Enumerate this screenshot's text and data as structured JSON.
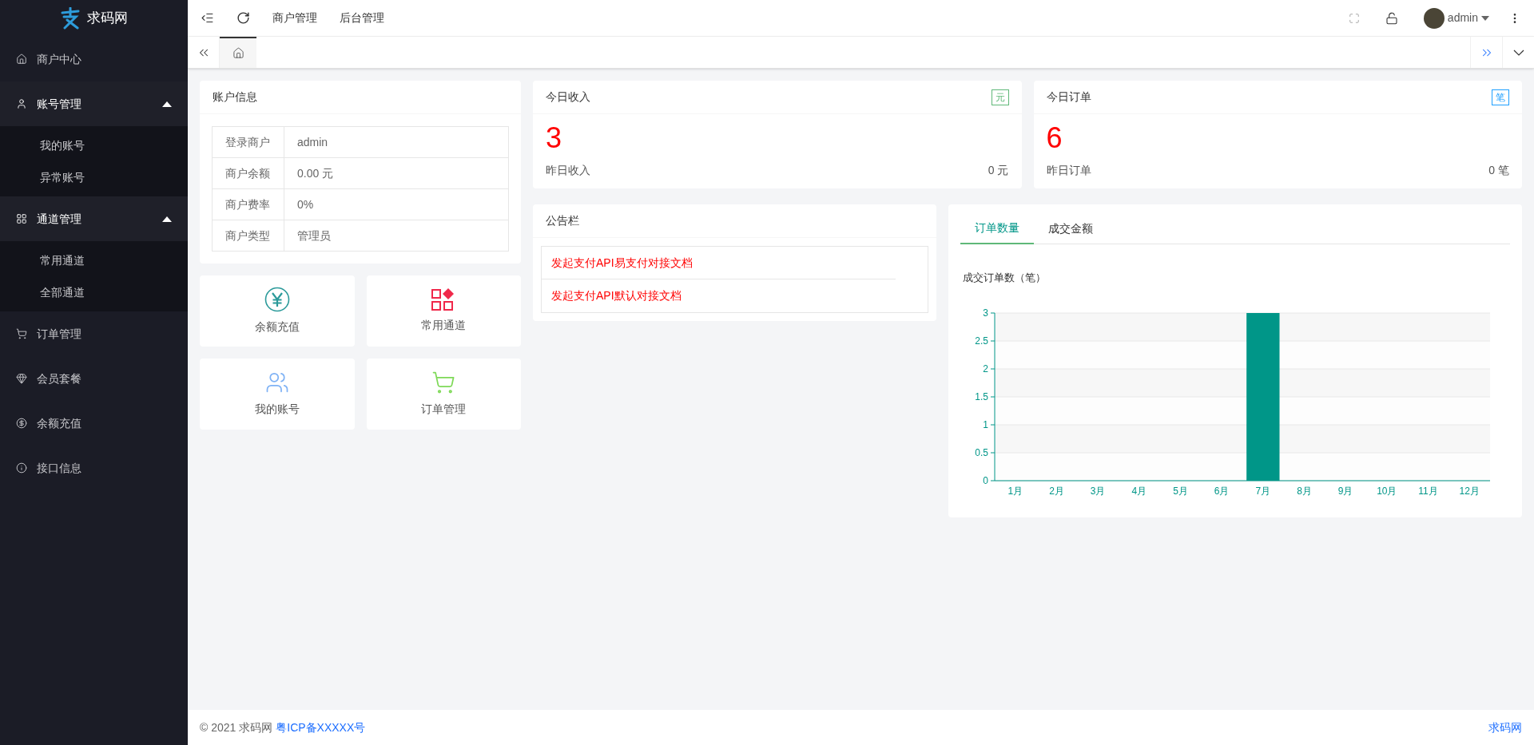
{
  "brand": {
    "name": "求码网"
  },
  "sidebar": {
    "items": [
      {
        "label": "商户中心"
      },
      {
        "label": "账号管理",
        "expanded": true,
        "children": [
          {
            "label": "我的账号"
          },
          {
            "label": "异常账号"
          }
        ]
      },
      {
        "label": "通道管理",
        "expanded": true,
        "children": [
          {
            "label": "常用通道"
          },
          {
            "label": "全部通道"
          }
        ]
      },
      {
        "label": "订单管理"
      },
      {
        "label": "会员套餐"
      },
      {
        "label": "余额充值"
      },
      {
        "label": "接口信息"
      }
    ]
  },
  "header": {
    "links": [
      "商户管理",
      "后台管理"
    ],
    "user": "admin"
  },
  "page_tabs": [
    {
      "selected": true
    }
  ],
  "account_info": {
    "title": "账户信息",
    "rows": [
      {
        "label": "登录商户",
        "value": "admin"
      },
      {
        "label": "商户余额",
        "value": "0.00 元"
      },
      {
        "label": "商户费率",
        "value": "0%"
      },
      {
        "label": "商户类型",
        "value": "管理员"
      }
    ]
  },
  "shortcuts": [
    {
      "label": "余额充值"
    },
    {
      "label": "常用通道"
    },
    {
      "label": "我的账号"
    },
    {
      "label": "订单管理"
    }
  ],
  "stats": [
    {
      "title": "今日收入",
      "badge": "元",
      "color": "#5fb878",
      "value": "3",
      "sub_label": "昨日收入",
      "sub_value": "0 元"
    },
    {
      "title": "今日订单",
      "badge": "笔",
      "color": "#1e9fff",
      "value": "6",
      "sub_label": "昨日订单",
      "sub_value": "0 笔"
    }
  ],
  "notices": {
    "title": "公告栏",
    "items": [
      "发起支付API易支付对接文档",
      "发起支付API默认对接文档"
    ]
  },
  "chart_panel": {
    "tabs": [
      {
        "label": "订单数量",
        "selected": true
      },
      {
        "label": "成交金额",
        "selected": false
      }
    ],
    "chart_data": {
      "type": "bar",
      "title": "成交订单数（笔）",
      "categories": [
        "1月",
        "2月",
        "3月",
        "4月",
        "5月",
        "6月",
        "7月",
        "8月",
        "9月",
        "10月",
        "11月",
        "12月"
      ],
      "values": [
        0,
        0,
        0,
        0,
        0,
        0,
        3,
        0,
        0,
        0,
        0,
        0
      ],
      "ylim": [
        0,
        3
      ],
      "grid": true,
      "yticks": [
        0,
        0.5,
        1,
        1.5,
        2,
        2.5,
        3
      ]
    }
  },
  "footer": {
    "copyright": "© 2021 求码网",
    "icp": "粤ICP备XXXXX号",
    "right_link": "求码网"
  }
}
